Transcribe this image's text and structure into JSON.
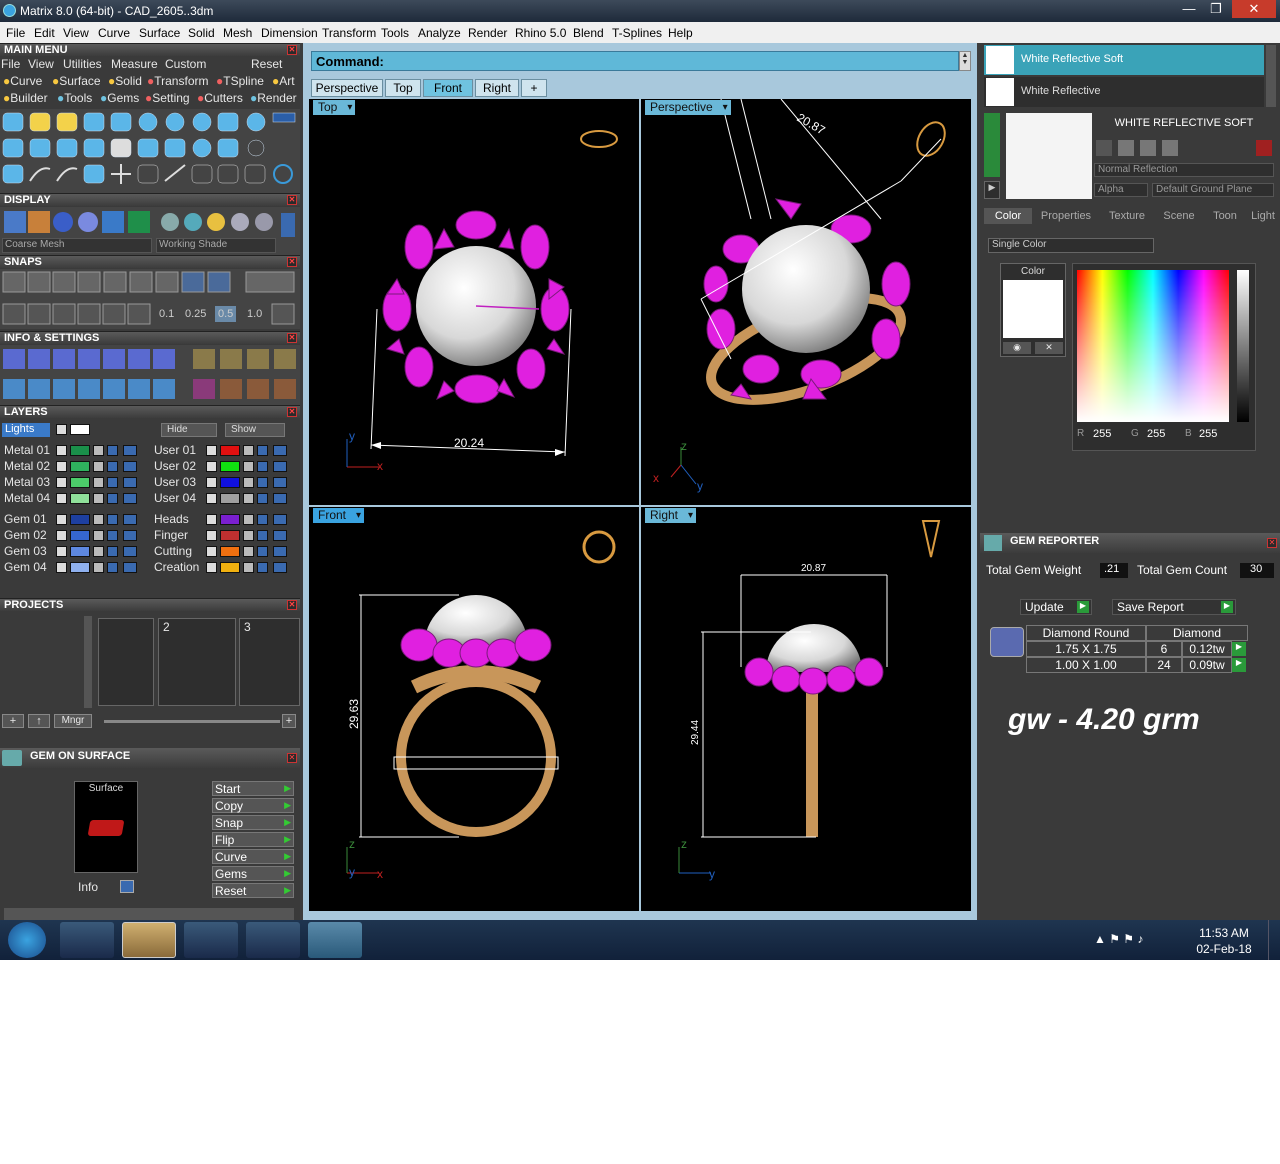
{
  "window": {
    "title": "Matrix 8.0 (64-bit) - CAD_2605..3dm",
    "min": "—",
    "max": "❐",
    "close": "✕"
  },
  "menubar": [
    "File",
    "Edit",
    "View",
    "Curve",
    "Surface",
    "Solid",
    "Mesh",
    "Dimension",
    "Transform",
    "Tools",
    "Analyze",
    "Render",
    "Rhino 5.0",
    "Blend",
    "T-Splines",
    "Help"
  ],
  "main_menu": {
    "title": "MAIN MENU",
    "row1": [
      "File",
      "View",
      "Utilities",
      "Measure",
      "Custom"
    ],
    "reset": "Reset",
    "row2": [
      "Curve",
      "Surface",
      "Solid",
      "Transform",
      "TSpline",
      "Art"
    ],
    "row3": [
      "Builder",
      "Tools",
      "Gems",
      "Setting",
      "Cutters",
      "Render"
    ]
  },
  "display": {
    "title": "DISPLAY",
    "mesh": "Coarse Mesh",
    "shade": "Working Shade"
  },
  "snaps": {
    "title": "SNAPS",
    "values": [
      "0.1",
      "0.25",
      "0.5",
      "1.0"
    ]
  },
  "info_settings": {
    "title": "INFO & SETTINGS"
  },
  "layers": {
    "title": "LAYERS",
    "lights": "Lights",
    "hide": "Hide",
    "show": "Show",
    "left": [
      {
        "name": "Metal 01",
        "color": "#1a8f4a"
      },
      {
        "name": "Metal 02",
        "color": "#2fb15e"
      },
      {
        "name": "Metal 03",
        "color": "#4ccc6a"
      },
      {
        "name": "Metal 04",
        "color": "#8fe09a"
      },
      {
        "name": "Gem 01",
        "color": "#1d3fa0"
      },
      {
        "name": "Gem 02",
        "color": "#3566d0"
      },
      {
        "name": "Gem 03",
        "color": "#5e88e0"
      },
      {
        "name": "Gem 04",
        "color": "#8fb0ee"
      }
    ],
    "right": [
      {
        "name": "User 01",
        "color": "#e01010"
      },
      {
        "name": "User 02",
        "color": "#10e010"
      },
      {
        "name": "User 03",
        "color": "#1010e0"
      },
      {
        "name": "User 04",
        "color": "#a0a0a0"
      },
      {
        "name": "Heads",
        "color": "#7a1fd0"
      },
      {
        "name": "Finger",
        "color": "#c03030"
      },
      {
        "name": "Cutting",
        "color": "#f07010"
      },
      {
        "name": "Creation",
        "color": "#f0b010"
      }
    ]
  },
  "projects": {
    "title": "PROJECTS",
    "slots": [
      "",
      "2",
      "3"
    ],
    "mngr": "Mngr"
  },
  "gem_on_surface": {
    "title": "GEM ON SURFACE",
    "surface": "Surface",
    "info": "Info",
    "buttons": [
      "Start",
      "Copy",
      "Snap",
      "Flip",
      "Curve",
      "Gems",
      "Reset"
    ]
  },
  "command": {
    "label": "Command:"
  },
  "view_tabs": [
    "Perspective",
    "Top",
    "Front",
    "Right",
    "+"
  ],
  "active_view_tab": "Front",
  "viewports": {
    "top": {
      "label": "Top",
      "dim": "20.24"
    },
    "perspective": {
      "label": "Perspective",
      "dim": "20.87"
    },
    "front": {
      "label": "Front",
      "dim": "29.63"
    },
    "right": {
      "label": "Right",
      "dim_h": "20.87",
      "dim_v": "29.44"
    }
  },
  "axes": {
    "x": "x",
    "y": "y",
    "z": "z"
  },
  "materials": {
    "list": [
      "White Reflective Soft",
      "White Reflective"
    ],
    "selected_name": "WHITE REFLECTIVE SOFT",
    "reflection": "Normal Reflection",
    "alpha": "Alpha",
    "ground": "Default Ground Plane",
    "tabs": [
      "Color",
      "Properties",
      "Texture",
      "Scene",
      "Toon",
      "Light"
    ],
    "mode": "Single Color",
    "color_label": "Color",
    "rgb": {
      "R": "255",
      "G": "255",
      "B": "255"
    }
  },
  "gem_reporter": {
    "title": "GEM REPORTER",
    "weight_label": "Total Gem Weight",
    "weight": ".21",
    "count_label": "Total Gem Count",
    "count": "30",
    "update": "Update",
    "save": "Save Report",
    "col1": "Diamond Round",
    "col2": "Diamond",
    "rows": [
      {
        "size": "1.75 X 1.75",
        "qty": "6",
        "tw": "0.12tw"
      },
      {
        "size": "1.00 X 1.00",
        "qty": "24",
        "tw": "0.09tw"
      }
    ],
    "note": "gw - 4.20 grm"
  },
  "taskbar": {
    "time": "11:53 AM",
    "date": "02-Feb-18"
  }
}
